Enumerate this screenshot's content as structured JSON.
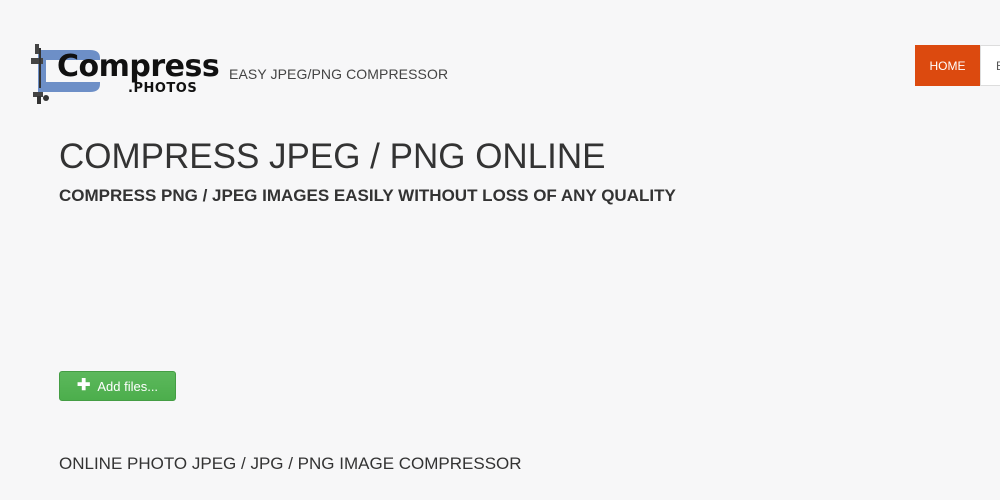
{
  "header": {
    "logo": {
      "main_text": "Compress",
      "sub_text": ".PHOTOS",
      "icon": "clamp-icon",
      "icon_color": "#6d8fc7"
    },
    "tagline": "EASY JPEG/PNG COMPRESSOR",
    "nav": [
      {
        "label": "HOME",
        "active": true
      },
      {
        "label": "E",
        "active": false
      }
    ]
  },
  "main": {
    "title": "COMPRESS JPEG / PNG ONLINE",
    "subtitle": "COMPRESS PNG / JPEG IMAGES EASILY WITHOUT LOSS OF ANY QUALITY",
    "add_button": {
      "icon": "plus-icon",
      "icon_glyph": "✚",
      "label": "Add files..."
    },
    "section_title": "ONLINE PHOTO JPEG / JPG / PNG IMAGE COMPRESSOR"
  },
  "colors": {
    "accent": "#dc4a0f",
    "button_green": "#5cb85c",
    "background": "#f7f7f8"
  }
}
